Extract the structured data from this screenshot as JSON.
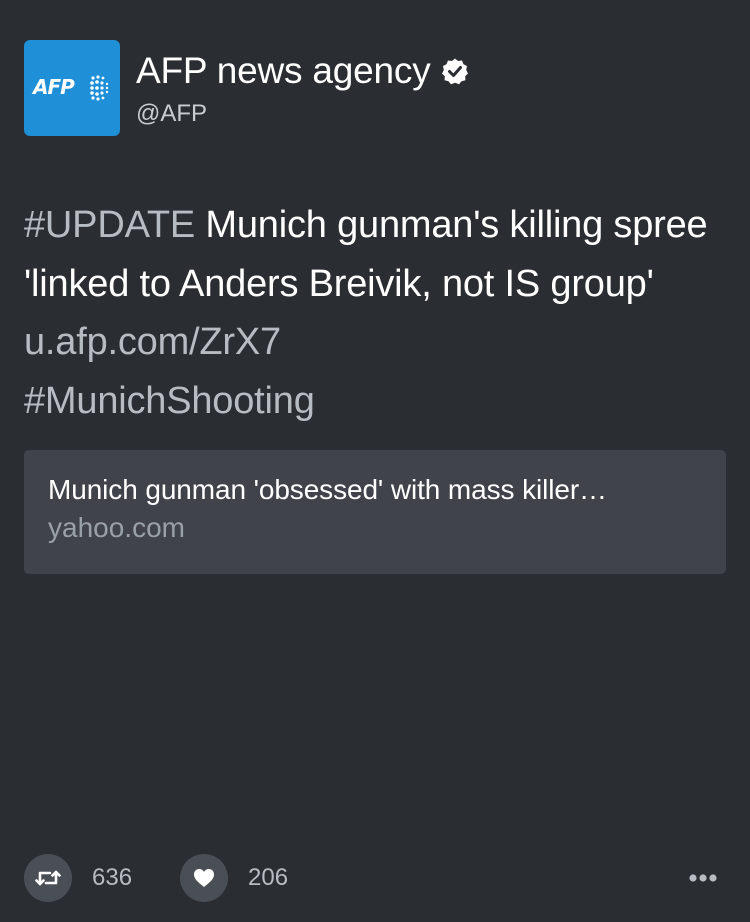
{
  "author": {
    "display_name": "AFP news agency",
    "handle": "@AFP",
    "avatar_logo_text": "AFP",
    "verified_icon": "verified-badge-icon"
  },
  "tweet": {
    "hashtag_update": "#UPDATE",
    "text_main": " Munich gunman's killing spree 'linked to Anders Breivik, not IS group' ",
    "link": "u.afp.com/ZrX7",
    "hashtag_munich": "#MunichShooting"
  },
  "card": {
    "title": "Munich gunman 'obsessed' with mass killer…",
    "domain": "yahoo.com"
  },
  "actions": {
    "retweet_icon": "retweet-icon",
    "retweet_count": "636",
    "like_icon": "heart-icon",
    "like_count": "206",
    "more_icon": "more-icon"
  },
  "colors": {
    "background": "#2a2d32",
    "card_background": "#40444a",
    "avatar_blue": "#1f8fd8",
    "muted_text": "#b7bcc2"
  }
}
